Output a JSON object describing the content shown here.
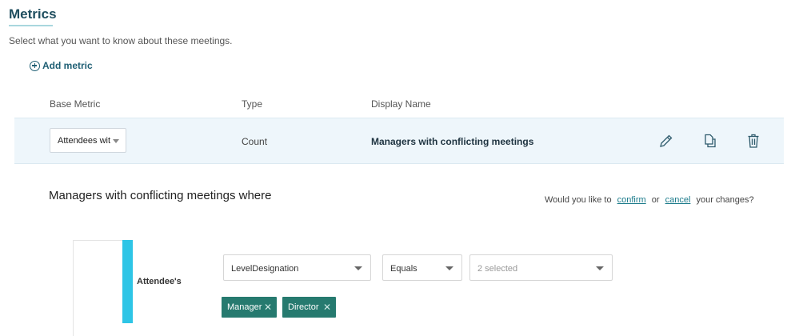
{
  "header": {
    "title": "Metrics",
    "subtitle": "Select what you want to know about these meetings."
  },
  "add_metric": {
    "label": "Add metric"
  },
  "columns": {
    "base_metric": "Base Metric",
    "type": "Type",
    "display_name": "Display Name"
  },
  "metric_row": {
    "base_metric_value": "Attendees wit",
    "type": "Count",
    "display_name": "Managers with conflicting meetings",
    "icons": [
      "edit-icon",
      "copy-icon",
      "delete-icon"
    ]
  },
  "condition": {
    "heading": "Managers with conflicting meetings where",
    "prompt_prefix": "Would you like to",
    "confirm_label": "confirm",
    "or_label": "or",
    "cancel_label": "cancel",
    "prompt_suffix": "your changes?"
  },
  "filter": {
    "group_label": "Attendee's",
    "field_value": "LevelDesignation",
    "operator_value": "Equals",
    "values_placeholder": "2 selected",
    "tags": [
      "Manager",
      "Director"
    ]
  },
  "colors": {
    "accent": "#2ec5e6",
    "tag": "#267a6f",
    "link": "#1a7a8a",
    "title": "#1f4e5f"
  }
}
